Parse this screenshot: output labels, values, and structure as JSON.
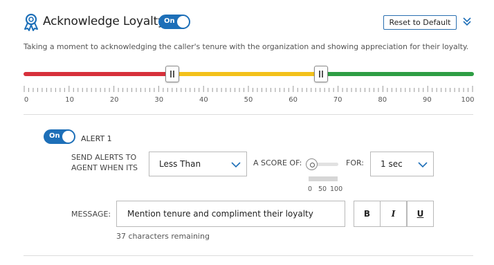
{
  "header": {
    "title": "Acknowledge Loyalty",
    "icon": "ribbon-award-icon",
    "toggle_label": "On",
    "reset_label": "Reset to Default",
    "collapse_icon": "double-chevron-down-icon"
  },
  "description": "Taking a moment to acknowledging the caller's tenure with the organization and showing appreciation for their loyalty.",
  "score_slider": {
    "low_threshold": 33,
    "high_threshold": 66,
    "min": 0,
    "max": 100,
    "tick_labels": [
      "0",
      "10",
      "20",
      "30",
      "40",
      "50",
      "60",
      "70",
      "80",
      "90",
      "100"
    ],
    "colors": {
      "low": "#d7303b",
      "mid": "#f3c11b",
      "high": "#2e9e44"
    }
  },
  "alert": {
    "toggle_label": "On",
    "title": "ALERT 1",
    "send_label_line1": "SEND ALERTS TO",
    "send_label_line2": "AGENT WHEN ITS",
    "comparison_value": "Less Than",
    "score_label": "A SCORE OF:",
    "score_value": 0,
    "score_tick_labels": [
      "0",
      "50",
      "100"
    ],
    "for_label": "FOR:",
    "duration_value": "1 sec",
    "message_label": "MESSAGE:",
    "message_value": "Mention tenure and compliment their loyalty",
    "bold_label": "B",
    "italic_label": "I",
    "underline_label": "U",
    "remaining_text": "37 characters remaining"
  },
  "accent_color": "#1d6fb8"
}
